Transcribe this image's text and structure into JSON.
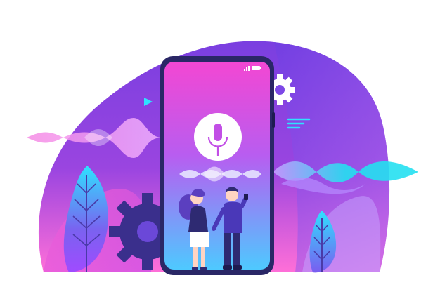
{
  "illustration": {
    "subject": "voice-assistant",
    "icons": [
      "microphone-icon",
      "gear-icon",
      "play-icon",
      "text-lines-icon"
    ],
    "status_bar": {
      "signal": "signal-bars-icon",
      "battery": "battery-icon"
    },
    "colors": {
      "blob_top": "#7a3fe0",
      "blob_bottom": "#ff6fd8",
      "screen_top": "#f347d3",
      "screen_bottom": "#4ec9ff",
      "phone_frame": "#2a2766",
      "gear": "#3a2f8c",
      "wave_cyan": "#24e0f0",
      "wave_pink": "#f58ae4",
      "leaf_cyan": "#2ee2ff"
    }
  }
}
